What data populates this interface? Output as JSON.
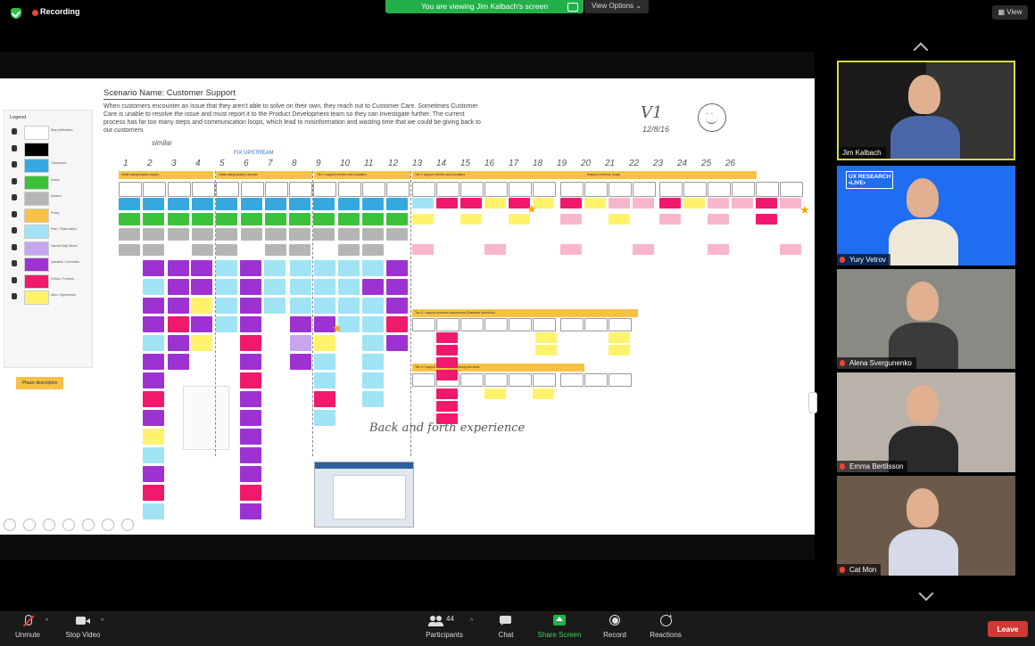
{
  "top_bar": {
    "recording_label": "Recording",
    "banner_text": "You are viewing Jim Kalbach's screen",
    "view_options_label": "View Options ⌄",
    "view_label": "View"
  },
  "shared_screen": {
    "scenario_title": "Scenario Name: Customer Support",
    "scenario_description": "When customers encounter an issue that they aren't able to solve on their own, they reach out to Customer Care. Sometimes Customer Care is unable to resolve the issue and must report it to the Product Development team so they can investigate further. The current process has far too many steps and communication loops, which lead to misinformation and wasting time that we could be giving back to our customers",
    "annotation_version": "V1",
    "annotation_date": "12/8/16",
    "annotation_similar": "similar",
    "annotation_upstream": "FIX UPSTREAM",
    "annotation_step_numbers": [
      "1",
      "2",
      "3",
      "4",
      "5",
      "6",
      "7",
      "8",
      "9",
      "10",
      "11",
      "12",
      "13",
      "14",
      "15",
      "16",
      "17",
      "18",
      "19",
      "20",
      "21",
      "22",
      "23",
      "24",
      "25",
      "26"
    ],
    "annotation_back_forth": "Back and forth experience",
    "legend_title": "Legend",
    "legend_items": [
      {
        "color": "#ffffff",
        "label": "Step (definition)"
      },
      {
        "color": "#000000",
        "label": ""
      },
      {
        "color": "#35a8e0",
        "label": "Touchpoint"
      },
      {
        "color": "#3cc13b",
        "label": "Action"
      },
      {
        "color": "#b5b5b5",
        "label": "System"
      },
      {
        "color": "#f7c244",
        "label": "Policy"
      },
      {
        "color": "#9fe3f5",
        "label": "Pain / Observation"
      },
      {
        "color": "#c7a6f0",
        "label": "Harold Daily Memo"
      },
      {
        "color": "#9d32d3",
        "label": "Question / Uncertain"
      },
      {
        "color": "#f0196b",
        "label": "Follow / Problem"
      },
      {
        "color": "#fff36b",
        "label": "Idea / Opportunity"
      }
    ],
    "phase_label": "Phase description",
    "lane_headers": [
      "Initial categorization inquiry",
      "Initial categorization attempt",
      "Tier 1 support verifies and escalates",
      "Tier 2 support verifies and escalates",
      "Support confirms, triage",
      "Tier 3 / support provides workaround (Standard Workflow)",
      "Tier 3 / support works on reproducing the issue"
    ],
    "colors": {
      "step": "#ffffff",
      "touchpoint": "#35a8e0",
      "action": "#3cc13b",
      "system": "#b5b5b5",
      "policy": "#f7c244",
      "pain": "#9fe3f5",
      "question": "#9d32d3",
      "problem": "#f0196b",
      "idea": "#fff36b",
      "pink": "#f8b6cc",
      "lavender": "#c7a6f0"
    }
  },
  "participants": [
    {
      "name": "Jim Kalbach",
      "active": true,
      "muted": false,
      "bg": "#444",
      "overlay_text": "Jim Kalbach"
    },
    {
      "name": "Yury Vetrov",
      "active": false,
      "muted": true,
      "bg": "#1f6df0",
      "overlay_text": "UX RESEARCH\n•LIVE•",
      "overlay_name": "Yury Vetrov"
    },
    {
      "name": "Alena Svergunenko",
      "active": false,
      "muted": true,
      "bg": "#8a8a84"
    },
    {
      "name": "Emma Bertilsson",
      "active": false,
      "muted": true,
      "bg": "#b9b2a8"
    },
    {
      "name": "Cat Mon",
      "active": false,
      "muted": true,
      "bg": "#6b5a4a"
    }
  ],
  "bottom_bar": {
    "unmute_label": "Unmute",
    "stop_video_label": "Stop Video",
    "participants_label": "Participants",
    "participants_count": "44",
    "chat_label": "Chat",
    "share_screen_label": "Share Screen",
    "record_label": "Record",
    "reactions_label": "Reactions",
    "leave_label": "Leave"
  }
}
